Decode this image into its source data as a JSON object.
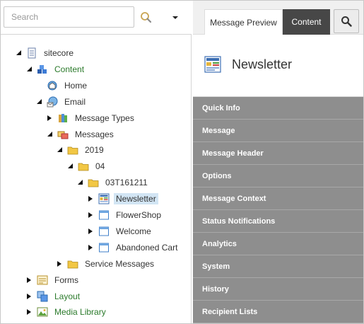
{
  "search": {
    "placeholder": "Search"
  },
  "tree": [
    {
      "label": "sitecore",
      "icon": "sitecore-doc-icon",
      "expanded": true,
      "green": false,
      "selected": false
    },
    {
      "label": "Content",
      "icon": "content-cubes-icon",
      "expanded": true,
      "green": true,
      "selected": false
    },
    {
      "label": "Home",
      "icon": "home-globe-icon",
      "expanded": null,
      "green": false,
      "selected": false
    },
    {
      "label": "Email",
      "icon": "email-globe-icon",
      "expanded": true,
      "green": false,
      "selected": false
    },
    {
      "label": "Message Types",
      "icon": "message-types-icon",
      "expanded": false,
      "green": false,
      "selected": false
    },
    {
      "label": "Messages",
      "icon": "messages-icon",
      "expanded": true,
      "green": false,
      "selected": false
    },
    {
      "label": "2019",
      "icon": "folder-icon",
      "expanded": true,
      "green": false,
      "selected": false
    },
    {
      "label": "04",
      "icon": "folder-icon",
      "expanded": true,
      "green": false,
      "selected": false
    },
    {
      "label": "03T161211",
      "icon": "folder-icon",
      "expanded": true,
      "green": false,
      "selected": false
    },
    {
      "label": "Newsletter",
      "icon": "newsletter-icon",
      "expanded": false,
      "green": false,
      "selected": true
    },
    {
      "label": "FlowerShop",
      "icon": "window-icon",
      "expanded": false,
      "green": false,
      "selected": false
    },
    {
      "label": "Welcome",
      "icon": "window-icon",
      "expanded": false,
      "green": false,
      "selected": false
    },
    {
      "label": "Abandoned Cart",
      "icon": "window-icon",
      "expanded": false,
      "green": false,
      "selected": false
    },
    {
      "label": "Service Messages",
      "icon": "folder-icon",
      "expanded": false,
      "green": false,
      "selected": false
    },
    {
      "label": "Forms",
      "icon": "forms-icon",
      "expanded": false,
      "green": false,
      "selected": false
    },
    {
      "label": "Layout",
      "icon": "layout-icon",
      "expanded": false,
      "green": true,
      "selected": false
    },
    {
      "label": "Media Library",
      "icon": "media-library-icon",
      "expanded": false,
      "green": true,
      "selected": false
    }
  ],
  "tabs": {
    "preview": "Message Preview",
    "content": "Content"
  },
  "item": {
    "title": "Newsletter"
  },
  "sections": [
    "Quick Info",
    "Message",
    "Message Header",
    "Options",
    "Message Context",
    "Status Notifications",
    "Analytics",
    "System",
    "History",
    "Recipient Lists"
  ],
  "colors": {
    "section_bg": "#8e8e8e",
    "active_tab": "#474747",
    "selected_bg": "#d2e5f4",
    "green_text": "#2b7a2b"
  }
}
